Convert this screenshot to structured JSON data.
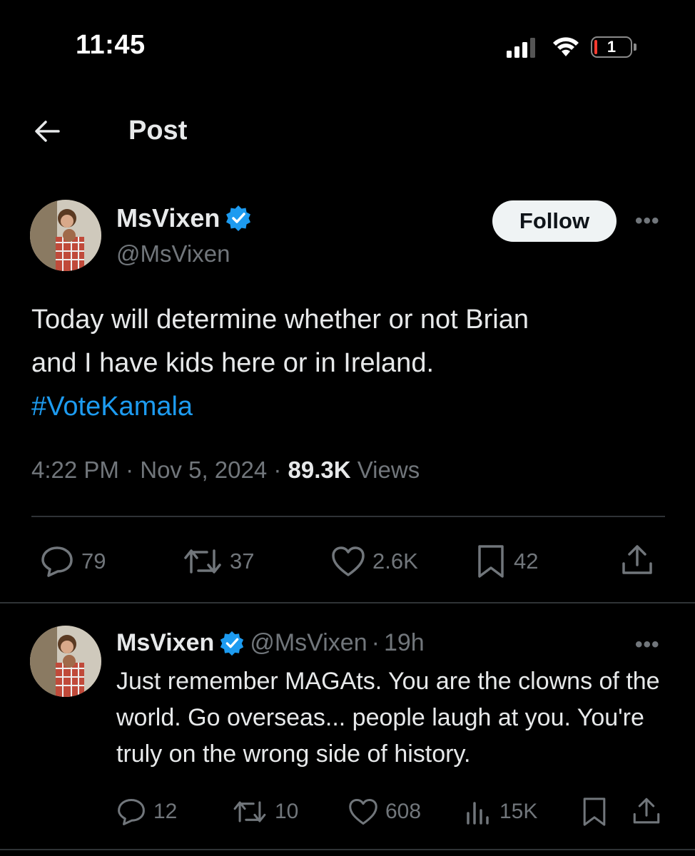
{
  "status_bar": {
    "time": "11:45",
    "battery_level": "1"
  },
  "header": {
    "title": "Post",
    "back_icon": "arrow-left-icon"
  },
  "post": {
    "author_name": "MsVixen",
    "handle": "@MsVixen",
    "follow_label": "Follow",
    "more_label": "•••",
    "text_line1": "Today will determine whether or not Brian",
    "text_line2": "and I have kids here or in Ireland.",
    "hashtag": "#VoteKamala",
    "time": "4:22 PM",
    "sep1": " · ",
    "date": "Nov 5, 2024",
    "sep2": " · ",
    "views_count": "89.3K",
    "views_label": "Views",
    "stats": {
      "replies": "79",
      "reposts": "37",
      "likes": "2.6K",
      "bookmarks": "42"
    }
  },
  "reply": {
    "author_name": "MsVixen",
    "handle": "@MsVixen",
    "sep": " · ",
    "age": "19h",
    "more_label": "•••",
    "text": "Just remember MAGAts. You are the clowns of the world. Go overseas... people laugh at you. You're truly on the wrong side of history.",
    "stats": {
      "replies": "12",
      "reposts": "10",
      "likes": "608",
      "views": "15K"
    }
  },
  "colors": {
    "background": "#000000",
    "text": "#e7e9ea",
    "muted": "#71767b",
    "link": "#1d9bf0",
    "verified": "#1d9bf0",
    "divider": "#2f3336"
  }
}
